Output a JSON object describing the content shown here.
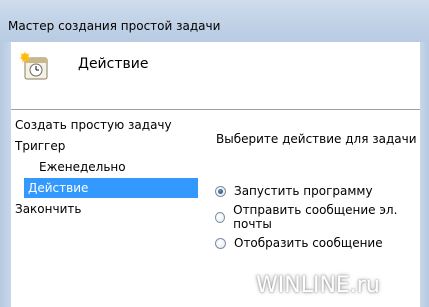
{
  "window": {
    "title": "Мастер создания простой задачи"
  },
  "header": {
    "title": "Действие",
    "icon": "task-scheduler-icon"
  },
  "nav": {
    "items": [
      {
        "label": "Создать простую задачу"
      },
      {
        "label": "Триггер"
      },
      {
        "label": "Еженедельно"
      },
      {
        "label": "Действие"
      },
      {
        "label": "Закончить"
      }
    ]
  },
  "main": {
    "prompt": "Выберите действие для задачи",
    "options": [
      {
        "label": "Запустить программу",
        "checked": true
      },
      {
        "label": "Отправить сообщение эл. почты",
        "checked": false
      },
      {
        "label": "Отобразить сообщение",
        "checked": false
      }
    ]
  },
  "watermark": {
    "text": "WINLINE.ru"
  },
  "colors": {
    "selection": "#3399ff",
    "titlebar": "#c2d3e7"
  }
}
